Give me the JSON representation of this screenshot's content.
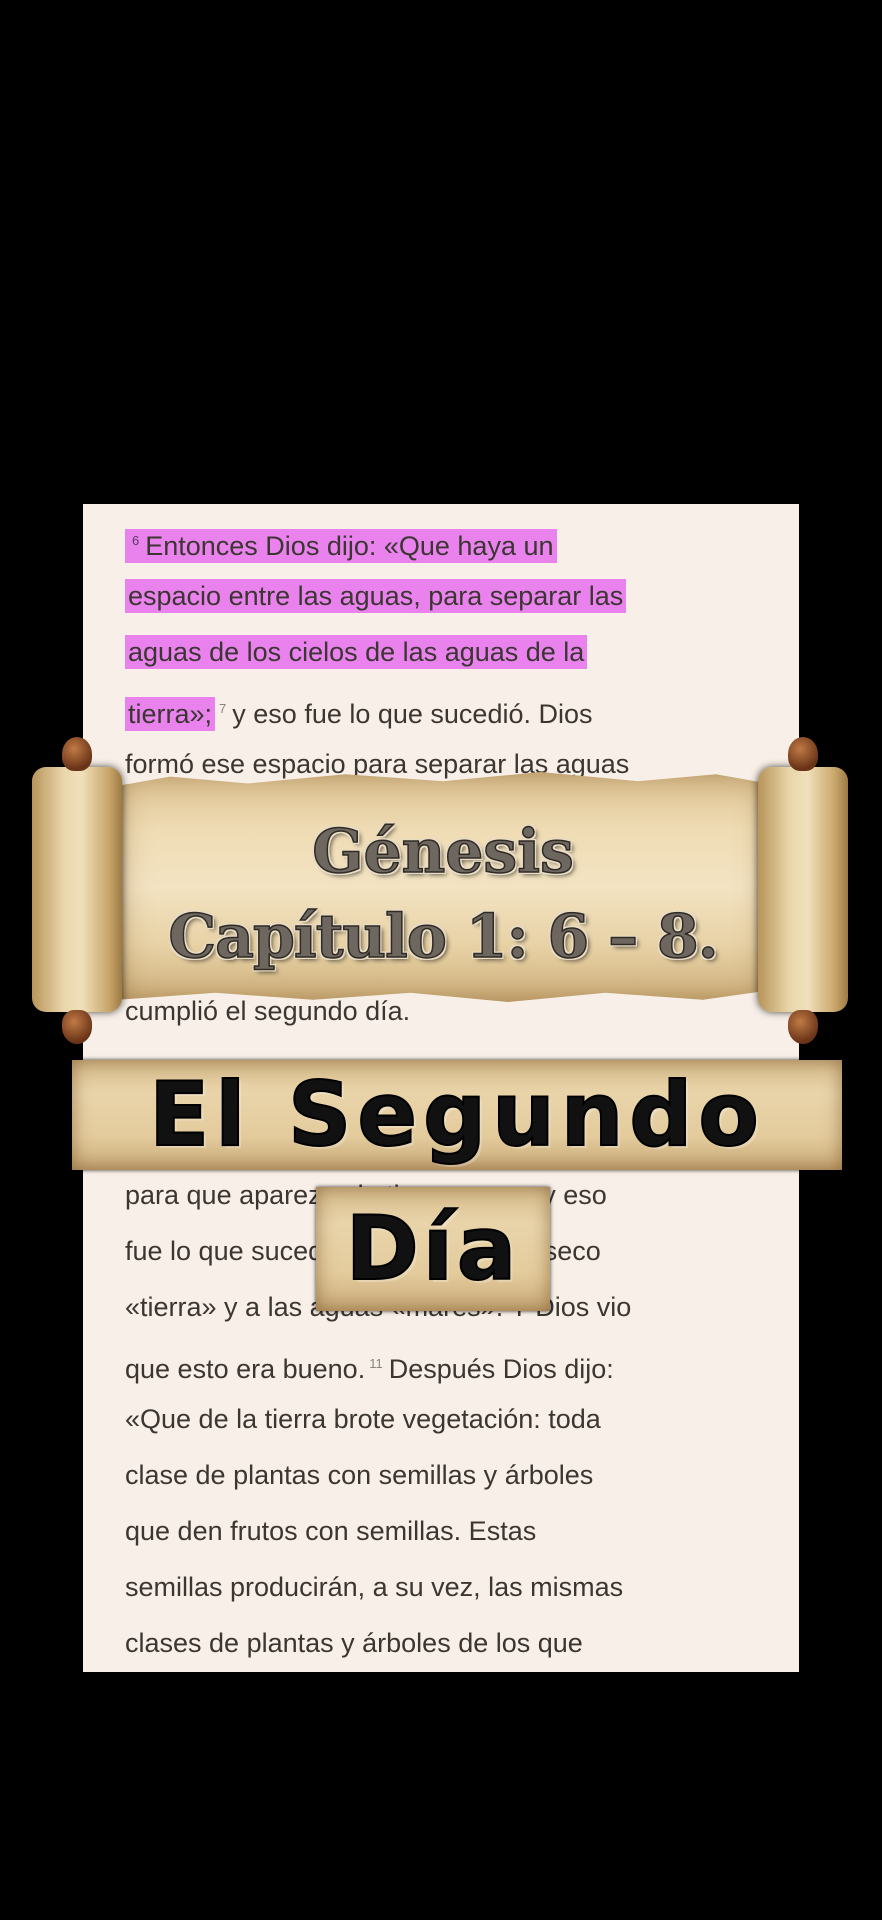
{
  "bible_text": {
    "lines": [
      {
        "verse": "6",
        "text": "Entonces Dios dijo: «Que haya un",
        "highlight": true
      },
      {
        "text": "espacio entre las aguas, para separar las",
        "highlight": true
      },
      {
        "text": "aguas de los cielos de las aguas de la",
        "highlight": true
      },
      {
        "text": "tierra»;",
        "highlight": true,
        "verse_after": "7",
        "rest": "y eso fue lo que sucedió. Dios"
      },
      {
        "text": "formó ese espacio para separar las aguas"
      },
      {
        "text": "cumplió el segundo día."
      },
      {
        "text": "para que aparezca la tierra seca»; y eso"
      },
      {
        "text": "fue lo que sucedió. Dios llamó a lo seco"
      },
      {
        "text": "«tierra» y a las aguas «mares». Y Dios vio"
      },
      {
        "text": "que esto era bueno.",
        "verse_after": "11",
        "rest": "Después Dios dijo:"
      },
      {
        "text": "«Que de la tierra brote vegetación: toda"
      },
      {
        "text": "clase de plantas con semillas y árboles"
      },
      {
        "text": "que den frutos con semillas. Estas"
      },
      {
        "text": "semillas producirán, a su vez, las mismas"
      },
      {
        "text": "clases de plantas y árboles de los que"
      }
    ]
  },
  "scroll_banner": {
    "title": "Génesis",
    "subtitle": "Capítulo 1: 6 – 8."
  },
  "overlay": {
    "line1": "El Segundo",
    "line2": "Día"
  },
  "colors": {
    "highlight": "#ea82ee",
    "page": "#f8f0e8",
    "background": "#000000"
  }
}
